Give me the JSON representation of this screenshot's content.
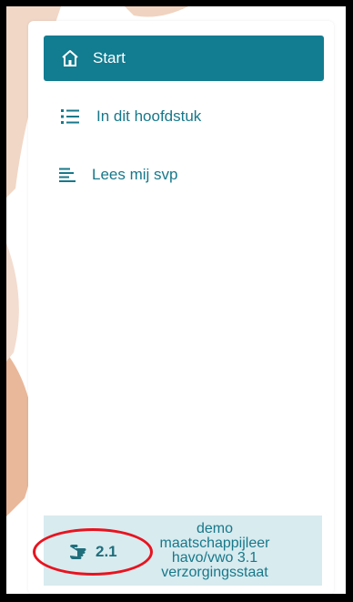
{
  "nav": {
    "items": [
      {
        "label": "Start",
        "icon": "home-icon",
        "active": true
      },
      {
        "label": "In dit hoofdstuk",
        "icon": "list-icon",
        "active": false
      },
      {
        "label": "Lees mij svp",
        "icon": "text-lines-icon",
        "active": false
      }
    ]
  },
  "footer": {
    "page_number": "2.1",
    "icon": "page-hand-icon",
    "description_lines": [
      "demo",
      "maatschappijleer",
      "havo/vwo 3.1",
      "verzorgingsstaat"
    ]
  },
  "colors": {
    "accent": "#127c90",
    "text": "#17788a",
    "footer_bg": "#d8ebef",
    "highlight": "#e8131f"
  }
}
